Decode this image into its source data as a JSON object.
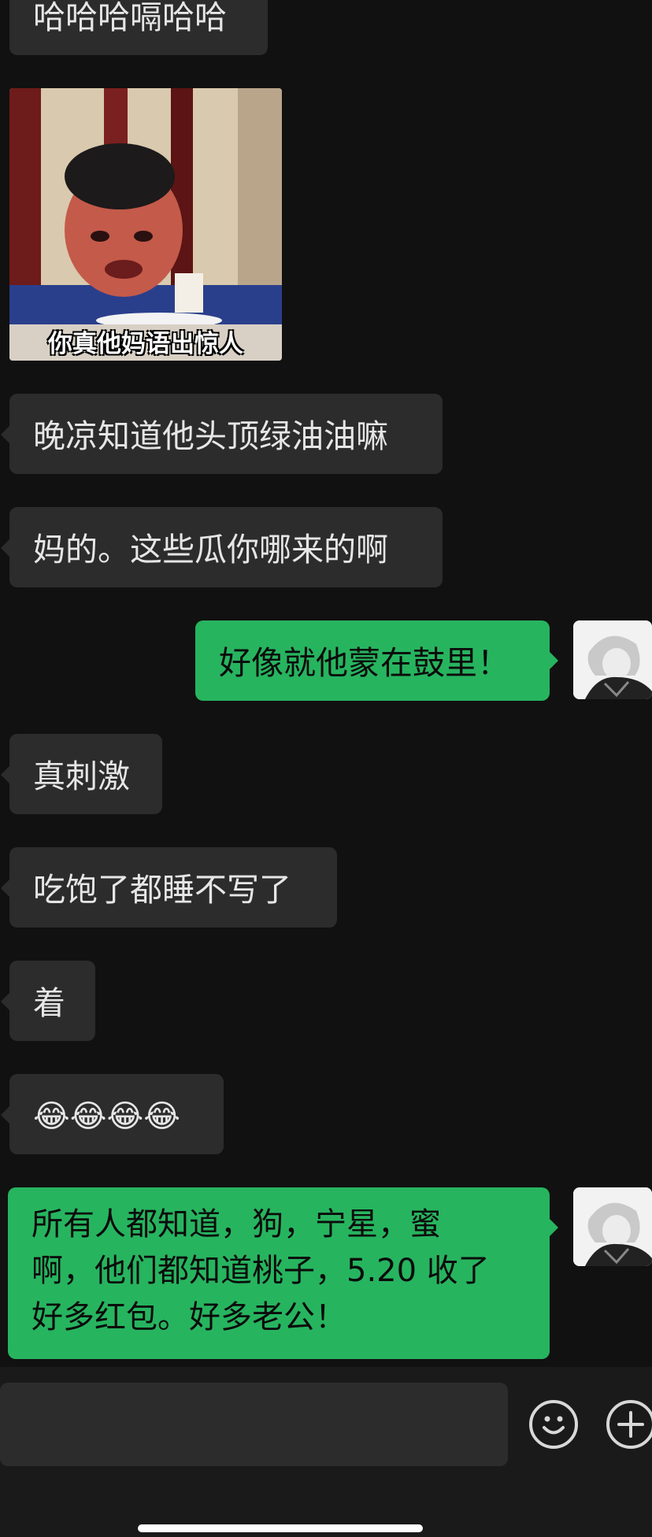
{
  "messages": [
    {
      "side": "left",
      "text": "哈哈哈嗝哈哈"
    },
    {
      "side": "left",
      "type": "image",
      "caption": "你真他妈语出惊人"
    },
    {
      "side": "left",
      "text": "晚凉知道他头顶绿油油嘛"
    },
    {
      "side": "left",
      "text": "妈的。这些瓜你哪来的啊"
    },
    {
      "side": "right",
      "text": "好像就他蒙在鼓里！"
    },
    {
      "side": "left",
      "text": "真刺激"
    },
    {
      "side": "left",
      "text": "吃饱了都睡不写了"
    },
    {
      "side": "left",
      "text": "着"
    },
    {
      "side": "left",
      "text": "😂😂😂😂"
    },
    {
      "side": "right",
      "lines": [
        "所有人都知道，狗，宁星，蜜",
        "啊，他们都知道桃子，5.20 收了",
        "好多红包。好多老公！"
      ]
    }
  ],
  "input": {
    "placeholder": ""
  },
  "icons": {
    "emoji": "emoji-icon",
    "plus": "plus-icon"
  },
  "colors": {
    "background": "#111111",
    "bubble_in": "#2c2c2c",
    "bubble_out": "#27b45f"
  }
}
